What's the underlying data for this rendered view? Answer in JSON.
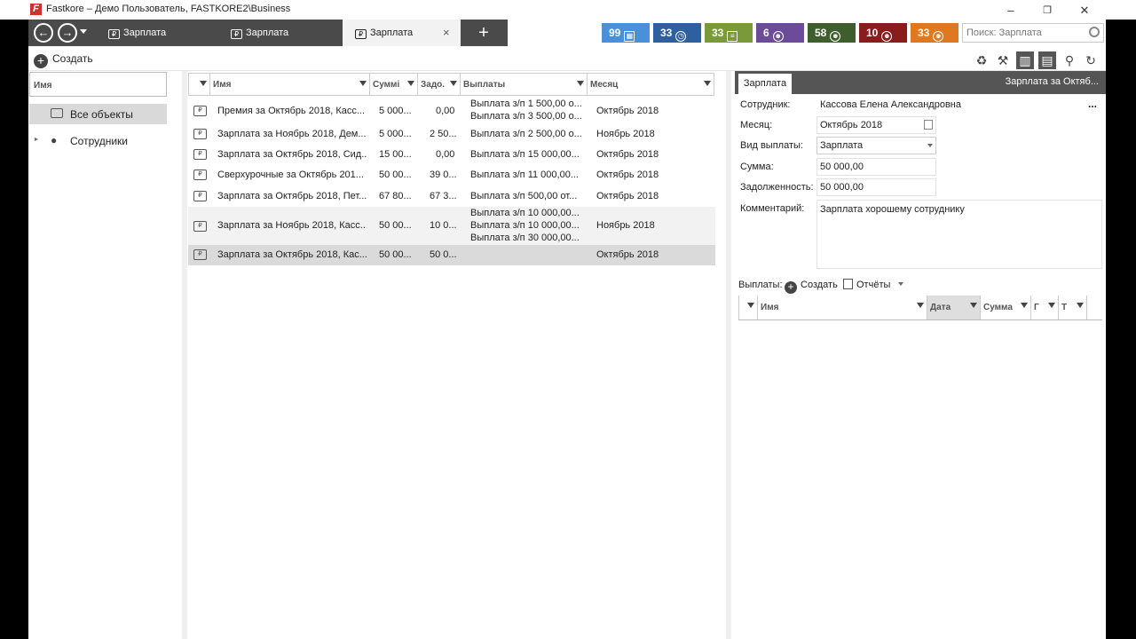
{
  "window": {
    "title": "Fastkore – Демо Пользователь, FASTKORE2\\Business",
    "logo_letter": "F",
    "minimize": "–",
    "maximize": "❐",
    "close": "✕"
  },
  "tabs": [
    {
      "label": "Зарплата"
    },
    {
      "label": "Зарплата"
    },
    {
      "label": "Зарплата"
    }
  ],
  "tab_close": "×",
  "tab_add": "+",
  "badges": [
    {
      "count": "99",
      "color": "#4a90d9"
    },
    {
      "count": "33",
      "color": "#2e5f9e"
    },
    {
      "count": "33",
      "color": "#7a9a3a"
    },
    {
      "count": "6",
      "color": "#6b4c9a"
    },
    {
      "count": "58",
      "color": "#3e5e2e"
    },
    {
      "count": "10",
      "color": "#8a1c1c"
    },
    {
      "count": "33",
      "color": "#e07820"
    }
  ],
  "search": {
    "placeholder": "Поиск: Зарплата"
  },
  "toolbar": {
    "create": "Создать"
  },
  "left": {
    "header": "Имя",
    "items": [
      {
        "label": "Все объекты"
      },
      {
        "label": "Сотрудники"
      }
    ]
  },
  "grid": {
    "columns": [
      "Имя",
      "Суммі",
      "Задо.",
      "Выплаты",
      "Месяц"
    ],
    "rows": [
      {
        "name": "Премия за Октябрь 2018, Касс...",
        "sum": "5 000...",
        "debt": "0,00",
        "payments": [
          "Выплата з/п 1 500,00 о...",
          "Выплата з/п 3 500,00 о..."
        ],
        "month": "Октябрь 2018"
      },
      {
        "name": "Зарплата за Ноябрь 2018, Дем...",
        "sum": "5 000...",
        "debt": "2 50...",
        "payments": [
          "Выплата з/п 2 500,00 о..."
        ],
        "month": "Ноябрь 2018"
      },
      {
        "name": "Зарплата за Октябрь 2018, Сид...",
        "sum": "15 00...",
        "debt": "0,00",
        "payments": [
          "Выплата з/п 15 000,00..."
        ],
        "month": "Октябрь 2018"
      },
      {
        "name": "Сверхурочные за Октябрь 201...",
        "sum": "50 00...",
        "debt": "39 0...",
        "payments": [
          "Выплата з/п 11 000,00..."
        ],
        "month": "Октябрь 2018"
      },
      {
        "name": "Зарплата за Октябрь 2018, Пет...",
        "sum": "67 80...",
        "debt": "67 3...",
        "payments": [
          "Выплата з/п 500,00 от..."
        ],
        "month": "Октябрь 2018"
      },
      {
        "name": "Зарплата за Ноябрь 2018, Касс...",
        "sum": "50 00...",
        "debt": "10 0...",
        "payments": [
          "Выплата з/п 10 000,00...",
          "Выплата з/п 10 000,00...",
          "Выплата з/п 30 000,00..."
        ],
        "month": "Ноябрь 2018"
      },
      {
        "name": "Зарплата за Октябрь 2018, Кас...",
        "sum": "50 00...",
        "debt": "50 0...",
        "payments": [],
        "month": "Октябрь 2018"
      }
    ]
  },
  "detail": {
    "tab": "Зарплата",
    "title": "Зарплата за Октяб...",
    "fields": {
      "employee_label": "Сотрудник:",
      "employee": "Кассова Елена Александровна",
      "more": "...",
      "month_label": "Месяц:",
      "month": "Октябрь 2018",
      "type_label": "Вид выплаты:",
      "type": "Зарплата",
      "sum_label": "Сумма:",
      "sum": "50 000,00",
      "debt_label": "Задолженность:",
      "debt": "50 000,00",
      "comment_label": "Комментарий:",
      "comment": "Зарплата хорошему сотруднику"
    },
    "payments_label": "Выплаты:",
    "payments_create": "Создать",
    "payments_reports": "Отчёты",
    "subgrid_columns": [
      "Имя",
      "Дата",
      "Сумма",
      "Г",
      "Т"
    ]
  }
}
